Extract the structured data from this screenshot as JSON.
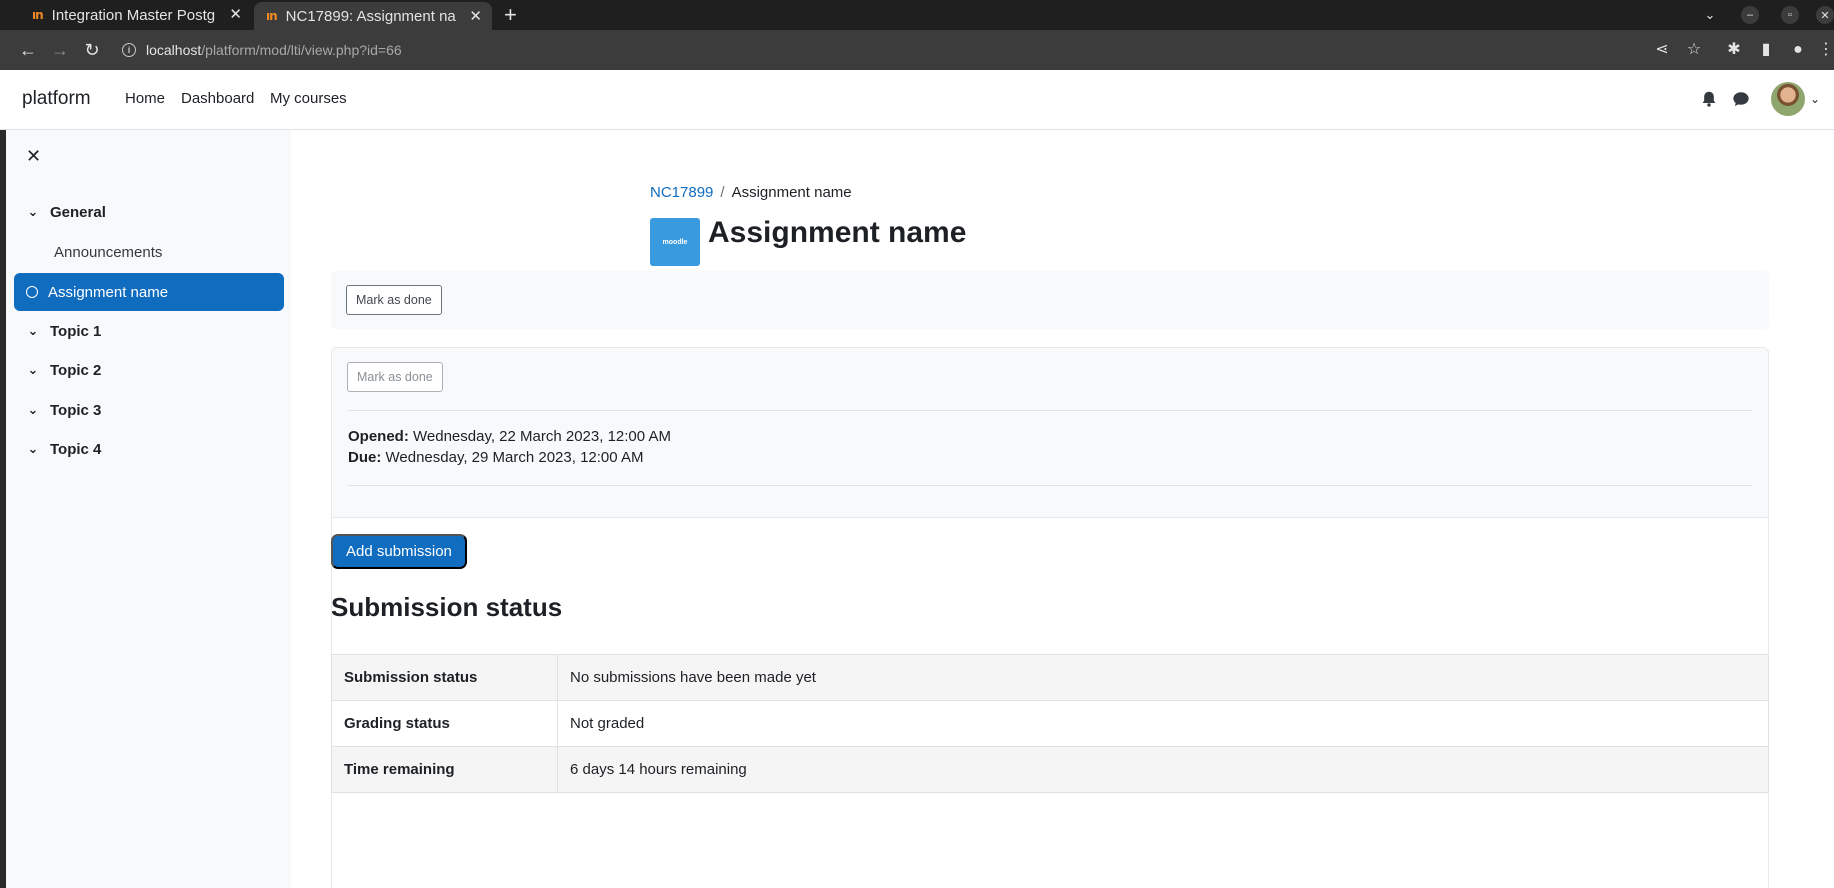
{
  "browser": {
    "tabs": [
      {
        "favicon": "ın",
        "title": "Integration Master Postg"
      },
      {
        "favicon": "ın",
        "title": "NC17899: Assignment na"
      }
    ],
    "url_host": "localhost",
    "url_path": "/platform/mod/lti/view.php?id=66"
  },
  "navbar": {
    "brand": "platform",
    "links": [
      "Home",
      "Dashboard",
      "My courses"
    ]
  },
  "drawer": {
    "sections": [
      {
        "label": "General"
      },
      {
        "label": "Announcements"
      },
      {
        "label": "Assignment name"
      },
      {
        "label": "Topic 1"
      },
      {
        "label": "Topic 2"
      },
      {
        "label": "Topic 3"
      },
      {
        "label": "Topic 4"
      }
    ]
  },
  "main": {
    "breadcrumb": {
      "course": "NC17899",
      "current": "Assignment name"
    },
    "module_icon_text": "moodle",
    "title": "Assignment name",
    "mark_done_label": "Mark as done",
    "mark_done_label_2": "Mark as done",
    "dates": {
      "opened_label": "Opened:",
      "opened_value": "Wednesday, 22 March 2023, 12:00 AM",
      "due_label": "Due:",
      "due_value": "Wednesday, 29 March 2023, 12:00 AM"
    },
    "add_submission_label": "Add submission",
    "status_heading": "Submission status",
    "status_rows": [
      {
        "key": "Submission status",
        "value": "No submissions have been made yet"
      },
      {
        "key": "Grading status",
        "value": "Not graded"
      },
      {
        "key": "Time remaining",
        "value": "6 days 14 hours remaining"
      }
    ]
  }
}
